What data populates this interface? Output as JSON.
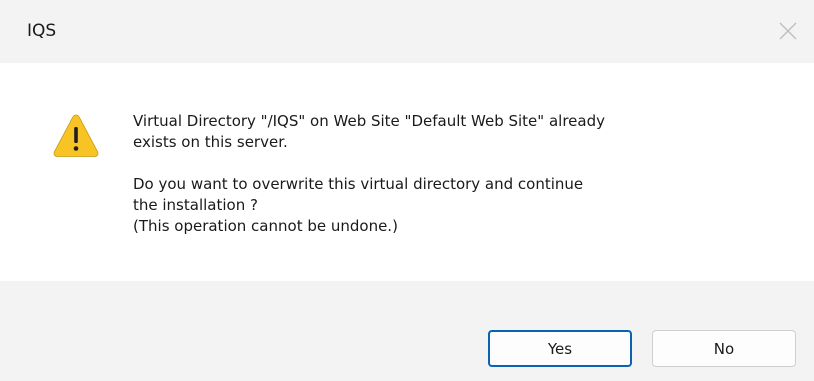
{
  "window": {
    "title": "IQS",
    "close_glyph": "close-icon"
  },
  "message": {
    "icon": "warning-icon",
    "line1": "Virtual Directory \"/IQS\" on Web Site \"Default Web Site\" already",
    "line2": "exists on this server.",
    "line3": "Do you want to overwrite this virtual directory and continue",
    "line4": "the installation ?",
    "line5": "(This operation cannot be undone.)"
  },
  "buttons": {
    "yes_label": "Yes",
    "no_label": "No",
    "default_button": "Yes"
  },
  "colors": {
    "titlebar_bg": "#f3f3f3",
    "footer_bg": "#f3f3f3",
    "default_button_border": "#0a62b7",
    "warning_fill": "#f7c325"
  }
}
